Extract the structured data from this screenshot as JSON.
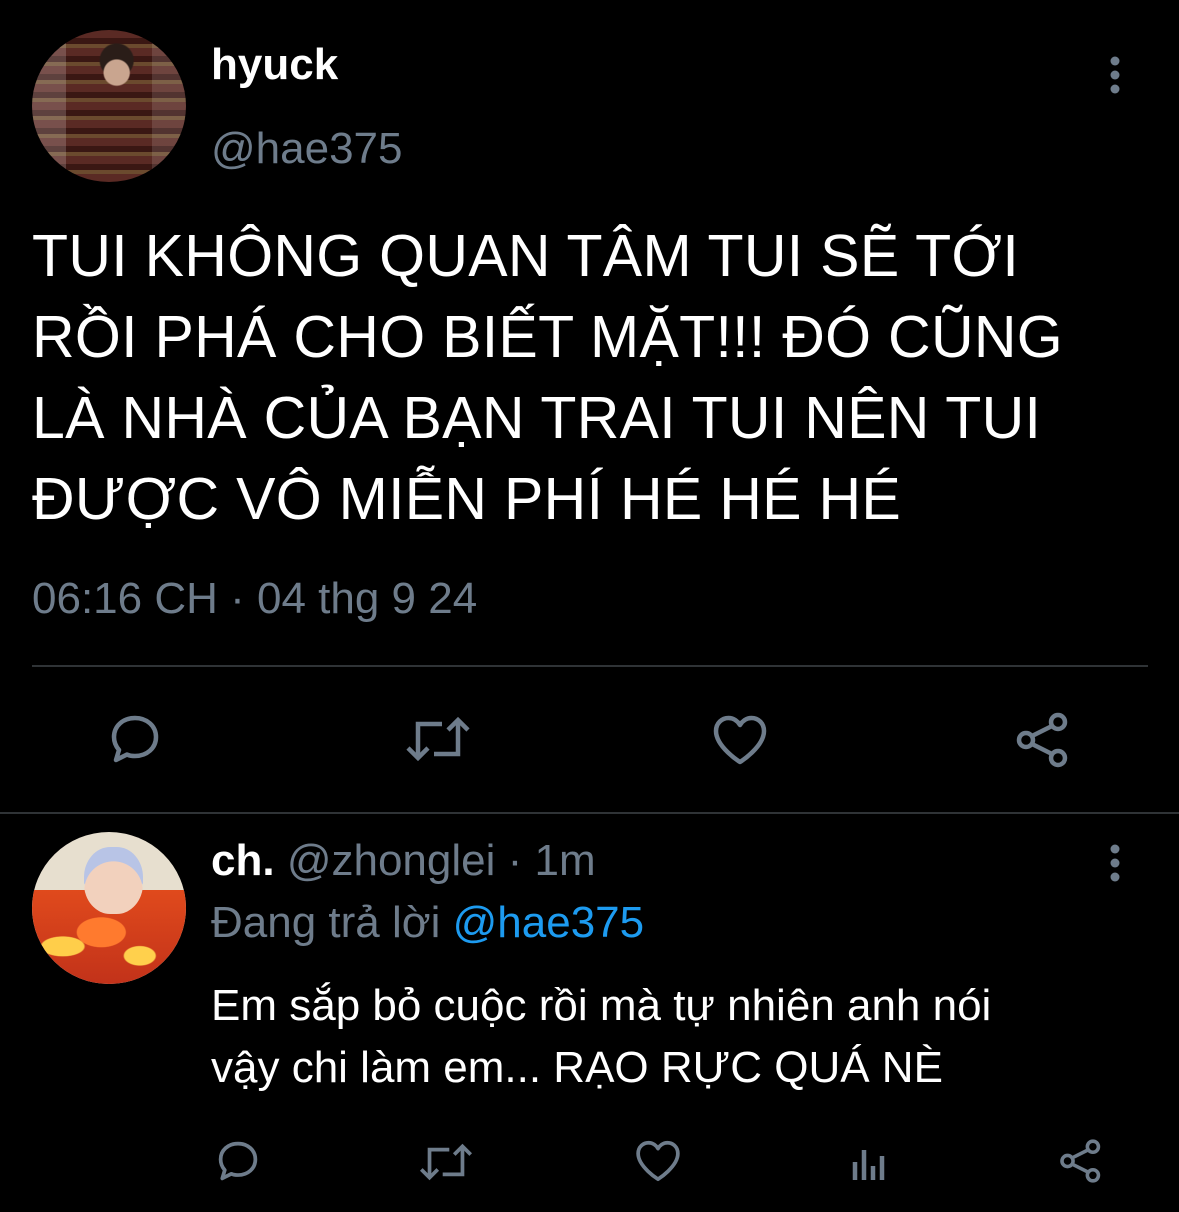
{
  "main_tweet": {
    "display_name": "hyuck",
    "handle": "@hae375",
    "text_lines": [
      "TUI KHÔNG QUAN TÂM TUI SẼ TỚI",
      "RỒI PHÁ CHO BIẾT MẶT!!! ĐÓ CŨNG",
      "LÀ NHÀ CỦA BẠN TRAI TUI NÊN TUI",
      "ĐƯỢC VÔ MIỄN PHÍ HÉ HÉ HÉ"
    ],
    "timestamp": "06:16 CH · 04 thg 9 24",
    "actions": [
      "reply-icon",
      "retweet-icon",
      "like-icon",
      "share-icon"
    ]
  },
  "reply": {
    "display_name": "ch.",
    "handle": "@zhonglei",
    "time": "· 1m",
    "replying_prefix": "Đang trả lời",
    "replying_to": "@hae375",
    "text_lines": [
      "Em sắp bỏ cuộc rồi mà tự nhiên anh nói",
      "vậy chi làm em... RẠO RỰC QUÁ NÈ"
    ],
    "actions": [
      "reply-icon",
      "retweet-icon",
      "like-icon",
      "analytics-icon",
      "share-icon"
    ]
  },
  "colors": {
    "background": "#000000",
    "text": "#ffffff",
    "muted": "#6e7c8b",
    "link": "#1d9bf0"
  }
}
